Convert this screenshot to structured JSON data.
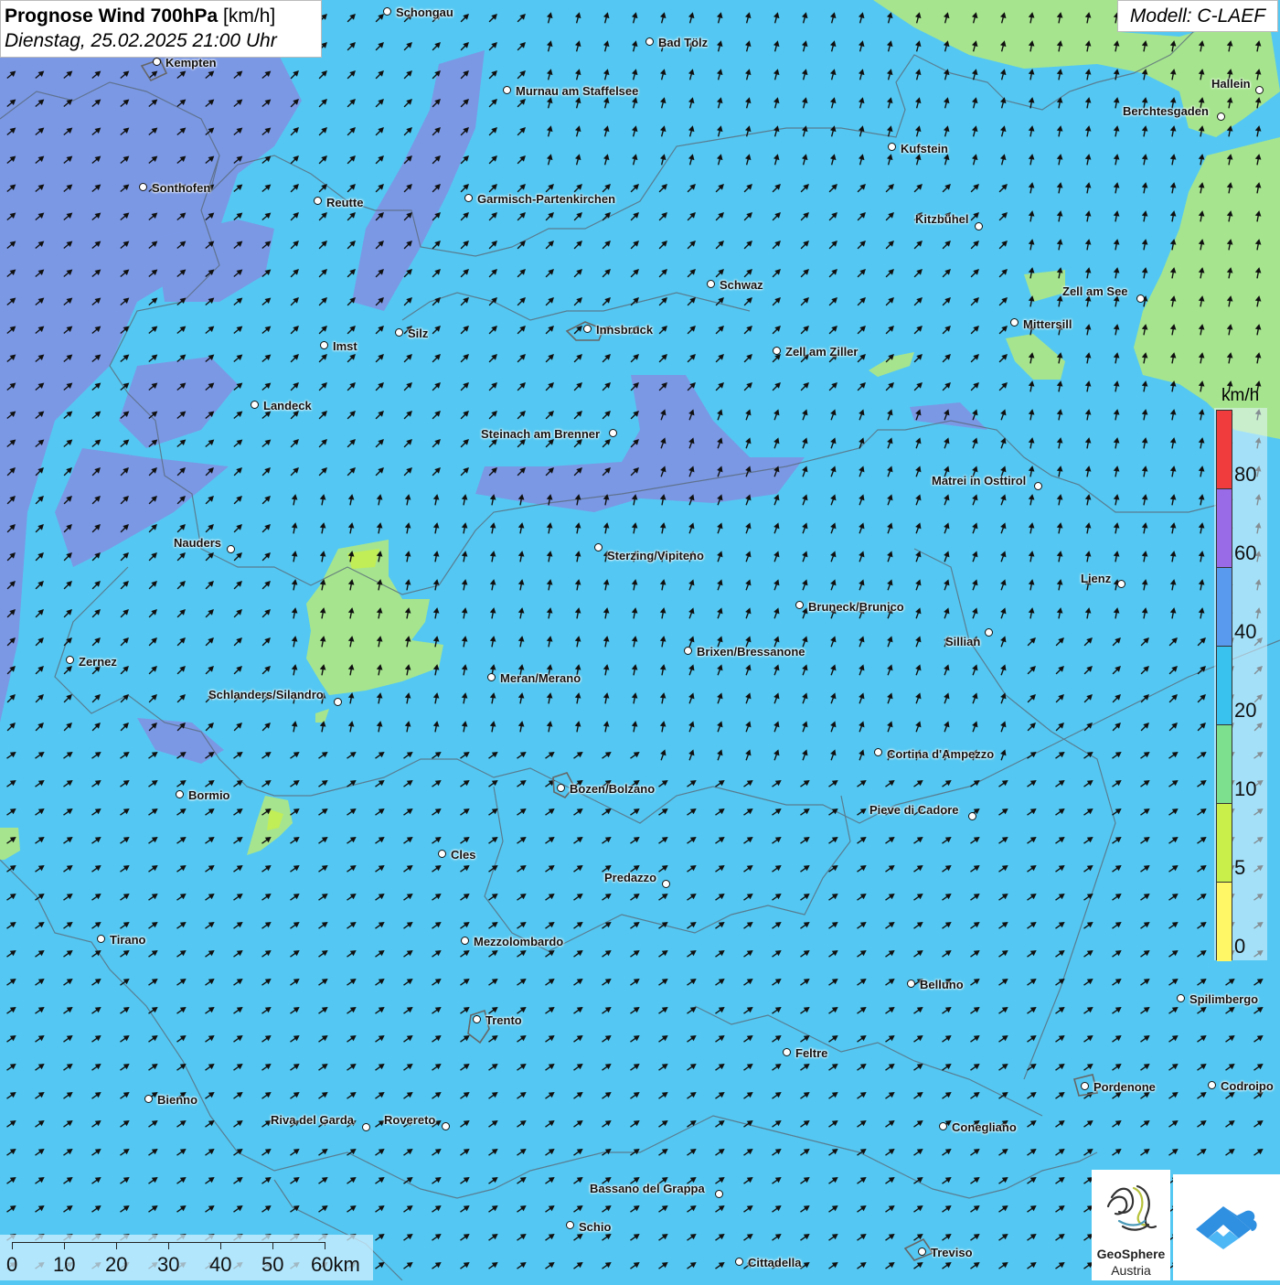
{
  "title": {
    "main": "Prognose Wind 700hPa",
    "unit": "[km/h]",
    "datetime": "Dienstag, 25.02.2025 21:00 Uhr"
  },
  "model": "Modell: C-LAEF",
  "legend": {
    "unit": "km/h",
    "ticks": [
      "80",
      "60",
      "40",
      "20",
      "10",
      "5",
      "0"
    ],
    "colors": [
      "#f03c3c",
      "#9a6be6",
      "#5a9aee",
      "#39c2ee",
      "#7de08e",
      "#c8ef4a",
      "#fff765"
    ]
  },
  "scale": {
    "labels": [
      "0",
      "10",
      "20",
      "30",
      "40",
      "50",
      "60km"
    ]
  },
  "logo": {
    "name_line1": "GeoSphere",
    "name_line2": "Austria"
  },
  "colors": {
    "base": "#54c8f2",
    "strong": "#7f94e4",
    "weak": "#a6e58e"
  },
  "cities": [
    {
      "name": "Schongau"
    },
    {
      "name": "Bad Tölz"
    },
    {
      "name": "Kempten"
    },
    {
      "name": "Murnau am Staffelsee"
    },
    {
      "name": "Hallein"
    },
    {
      "name": "Berchtesgaden"
    },
    {
      "name": "Kufstein"
    },
    {
      "name": "Sonthofen"
    },
    {
      "name": "Reutte"
    },
    {
      "name": "Garmisch-Partenkirchen"
    },
    {
      "name": "Kitzbühel"
    },
    {
      "name": "Schwaz"
    },
    {
      "name": "Zell am See"
    },
    {
      "name": "Mittersill"
    },
    {
      "name": "Innsbruck"
    },
    {
      "name": "Silz"
    },
    {
      "name": "Imst"
    },
    {
      "name": "Zell am Ziller"
    },
    {
      "name": "Landeck"
    },
    {
      "name": "Steinach am Brenner"
    },
    {
      "name": "Matrei in Osttirol"
    },
    {
      "name": "Nauders"
    },
    {
      "name": "Sterzing/Vipiteno"
    },
    {
      "name": "Lienz"
    },
    {
      "name": "Bruneck/Brunico"
    },
    {
      "name": "Sillian"
    },
    {
      "name": "Zernez"
    },
    {
      "name": "Brixen/Bressanone"
    },
    {
      "name": "Meran/Merano"
    },
    {
      "name": "Schlanders/Silandro"
    },
    {
      "name": "Cortina d'Ampezzo"
    },
    {
      "name": "Bozen/Bolzano"
    },
    {
      "name": "Bormio"
    },
    {
      "name": "Pieve di Cadore"
    },
    {
      "name": "Cles"
    },
    {
      "name": "Predazzo"
    },
    {
      "name": "Tirano"
    },
    {
      "name": "Mezzolombardo"
    },
    {
      "name": "Belluno"
    },
    {
      "name": "Spilimbergo"
    },
    {
      "name": "Trento"
    },
    {
      "name": "Feltre"
    },
    {
      "name": "Pordenone"
    },
    {
      "name": "Codroipo"
    },
    {
      "name": "Bienno"
    },
    {
      "name": "Riva del Garda"
    },
    {
      "name": "Rovereto"
    },
    {
      "name": "Conegliano"
    },
    {
      "name": "Bassano del Grappa"
    },
    {
      "name": "Schio"
    },
    {
      "name": "Treviso"
    },
    {
      "name": "Cittadella"
    }
  ]
}
